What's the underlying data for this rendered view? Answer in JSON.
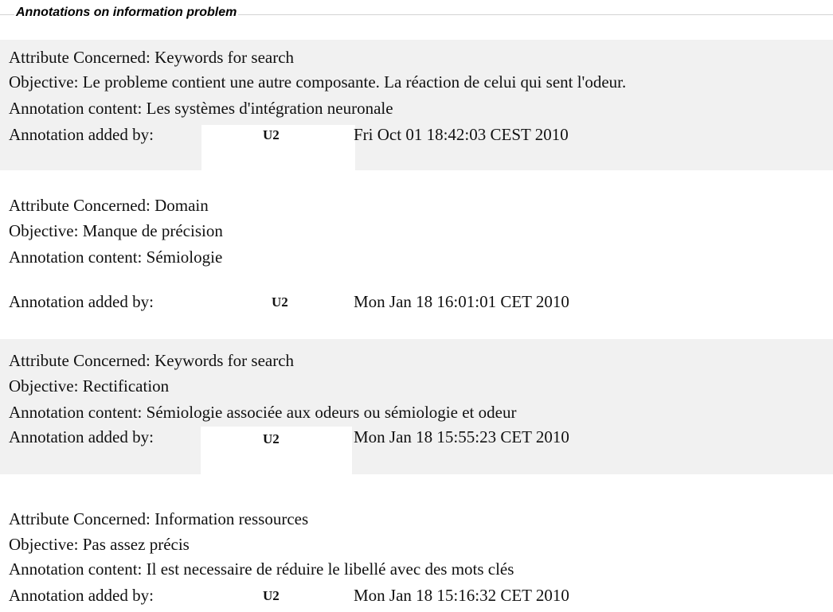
{
  "section": {
    "title": "Annotations on information problem"
  },
  "annotations": [
    {
      "attribute": "Attribute Concerned: Keywords for search",
      "objective": "Objective: Le probleme contient une autre composante. La réaction de celui qui sent l'odeur.",
      "content": "Annotation content: Les systèmes d'intégration neuronale",
      "added_by_label": "Annotation added by:",
      "user": "U2",
      "date": "Fri Oct 01 18:42:03 CEST 2010"
    },
    {
      "attribute": "Attribute Concerned: Domain",
      "objective": "Objective: Manque de précision",
      "content": "Annotation content: Sémiologie",
      "added_by_label": "Annotation added by:",
      "user": "U2",
      "date": "Mon Jan 18 16:01:01 CET 2010"
    },
    {
      "attribute": "Attribute Concerned: Keywords for search",
      "objective": "Objective: Rectification",
      "content": "Annotation content: Sémiologie associée aux odeurs ou sémiologie et odeur",
      "added_by_label": "Annotation added by:",
      "user": "U2",
      "date": "Mon Jan 18 15:55:23 CET 2010"
    },
    {
      "attribute": "Attribute Concerned: Information ressources",
      "objective": "Objective: Pas assez précis",
      "content": "Annotation content: Il est necessaire de réduire le libellé avec des mots clés",
      "added_by_label": "Annotation added by:",
      "user": "U2",
      "date": "Mon Jan 18 15:16:32 CET 2010"
    }
  ]
}
